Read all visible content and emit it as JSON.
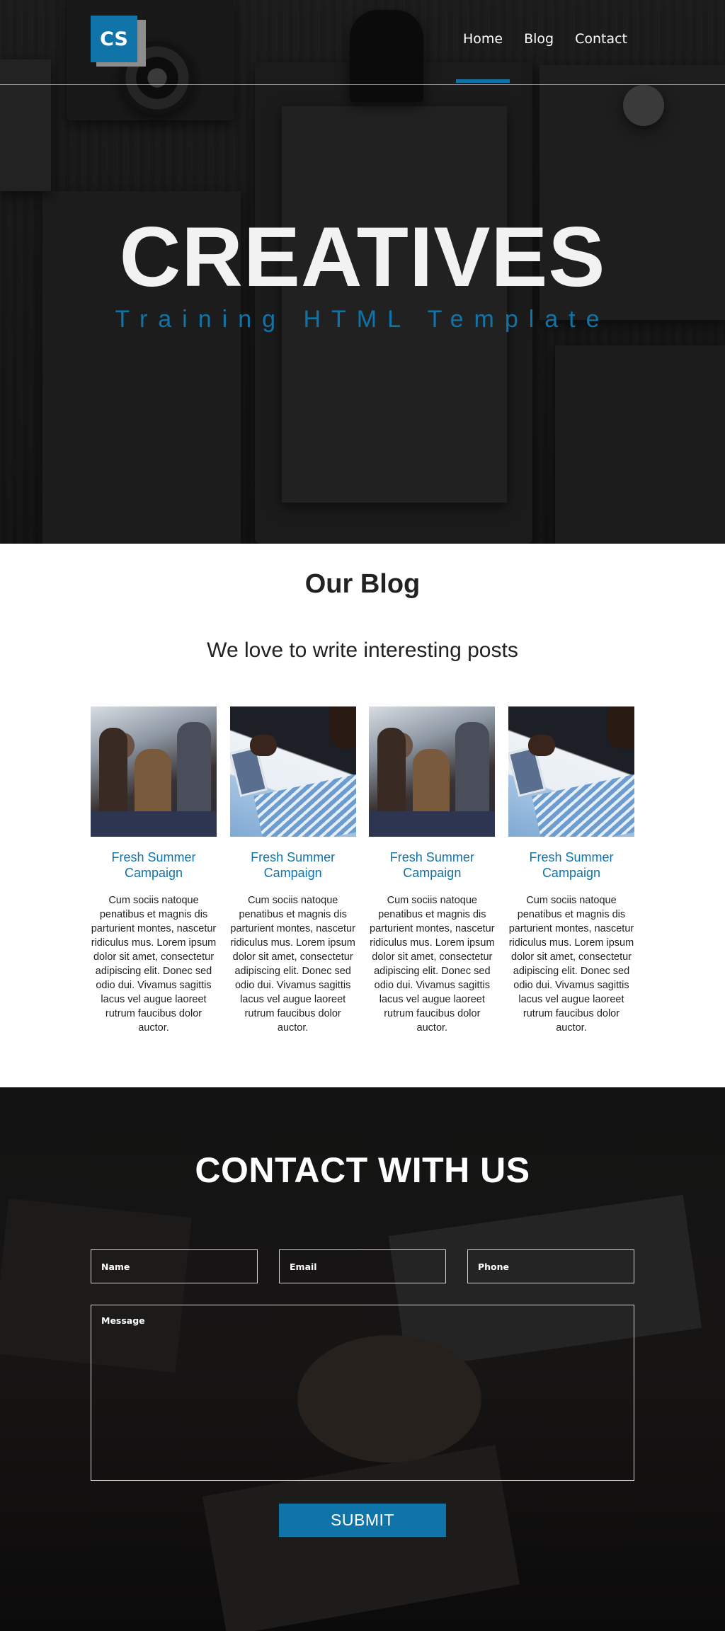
{
  "header": {
    "logo_text": "CS",
    "nav": [
      {
        "label": "Home",
        "active": true
      },
      {
        "label": "Blog",
        "active": false
      },
      {
        "label": "Contact",
        "active": false
      }
    ]
  },
  "hero": {
    "title": "CREATIVES",
    "subtitle": "Training HTML Template"
  },
  "blog": {
    "title": "Our Blog",
    "subtitle": "We love to write interesting posts",
    "posts": [
      {
        "title": "Fresh Summer Campaign",
        "text": "Cum sociis natoque penatibus et magnis dis parturient montes, nascetur ridiculus mus. Lorem ipsum dolor sit amet, consectetur adipiscing elit. Donec sed odio dui. Vivamus sagittis lacus vel augue laoreet rutrum faucibus dolor auctor."
      },
      {
        "title": "Fresh Summer Campaign",
        "text": "Cum sociis natoque penatibus et magnis dis parturient montes, nascetur ridiculus mus. Lorem ipsum dolor sit amet, consectetur adipiscing elit. Donec sed odio dui. Vivamus sagittis lacus vel augue laoreet rutrum faucibus dolor auctor."
      },
      {
        "title": "Fresh Summer Campaign",
        "text": "Cum sociis natoque penatibus et magnis dis parturient montes, nascetur ridiculus mus. Lorem ipsum dolor sit amet, consectetur adipiscing elit. Donec sed odio dui. Vivamus sagittis lacus vel augue laoreet rutrum faucibus dolor auctor."
      },
      {
        "title": "Fresh Summer Campaign",
        "text": "Cum sociis natoque penatibus et magnis dis parturient montes, nascetur ridiculus mus. Lorem ipsum dolor sit amet, consectetur adipiscing elit. Donec sed odio dui. Vivamus sagittis lacus vel augue laoreet rutrum faucibus dolor auctor."
      }
    ]
  },
  "contact": {
    "title": "CONTACT WITH US",
    "name_placeholder": "Name",
    "email_placeholder": "Email",
    "phone_placeholder": "Phone",
    "message_placeholder": "Message",
    "submit_label": "SUBMIT"
  },
  "colors": {
    "accent": "#1074a8",
    "logo_shadow": "#8d8d8d",
    "text_dark": "#222222"
  }
}
